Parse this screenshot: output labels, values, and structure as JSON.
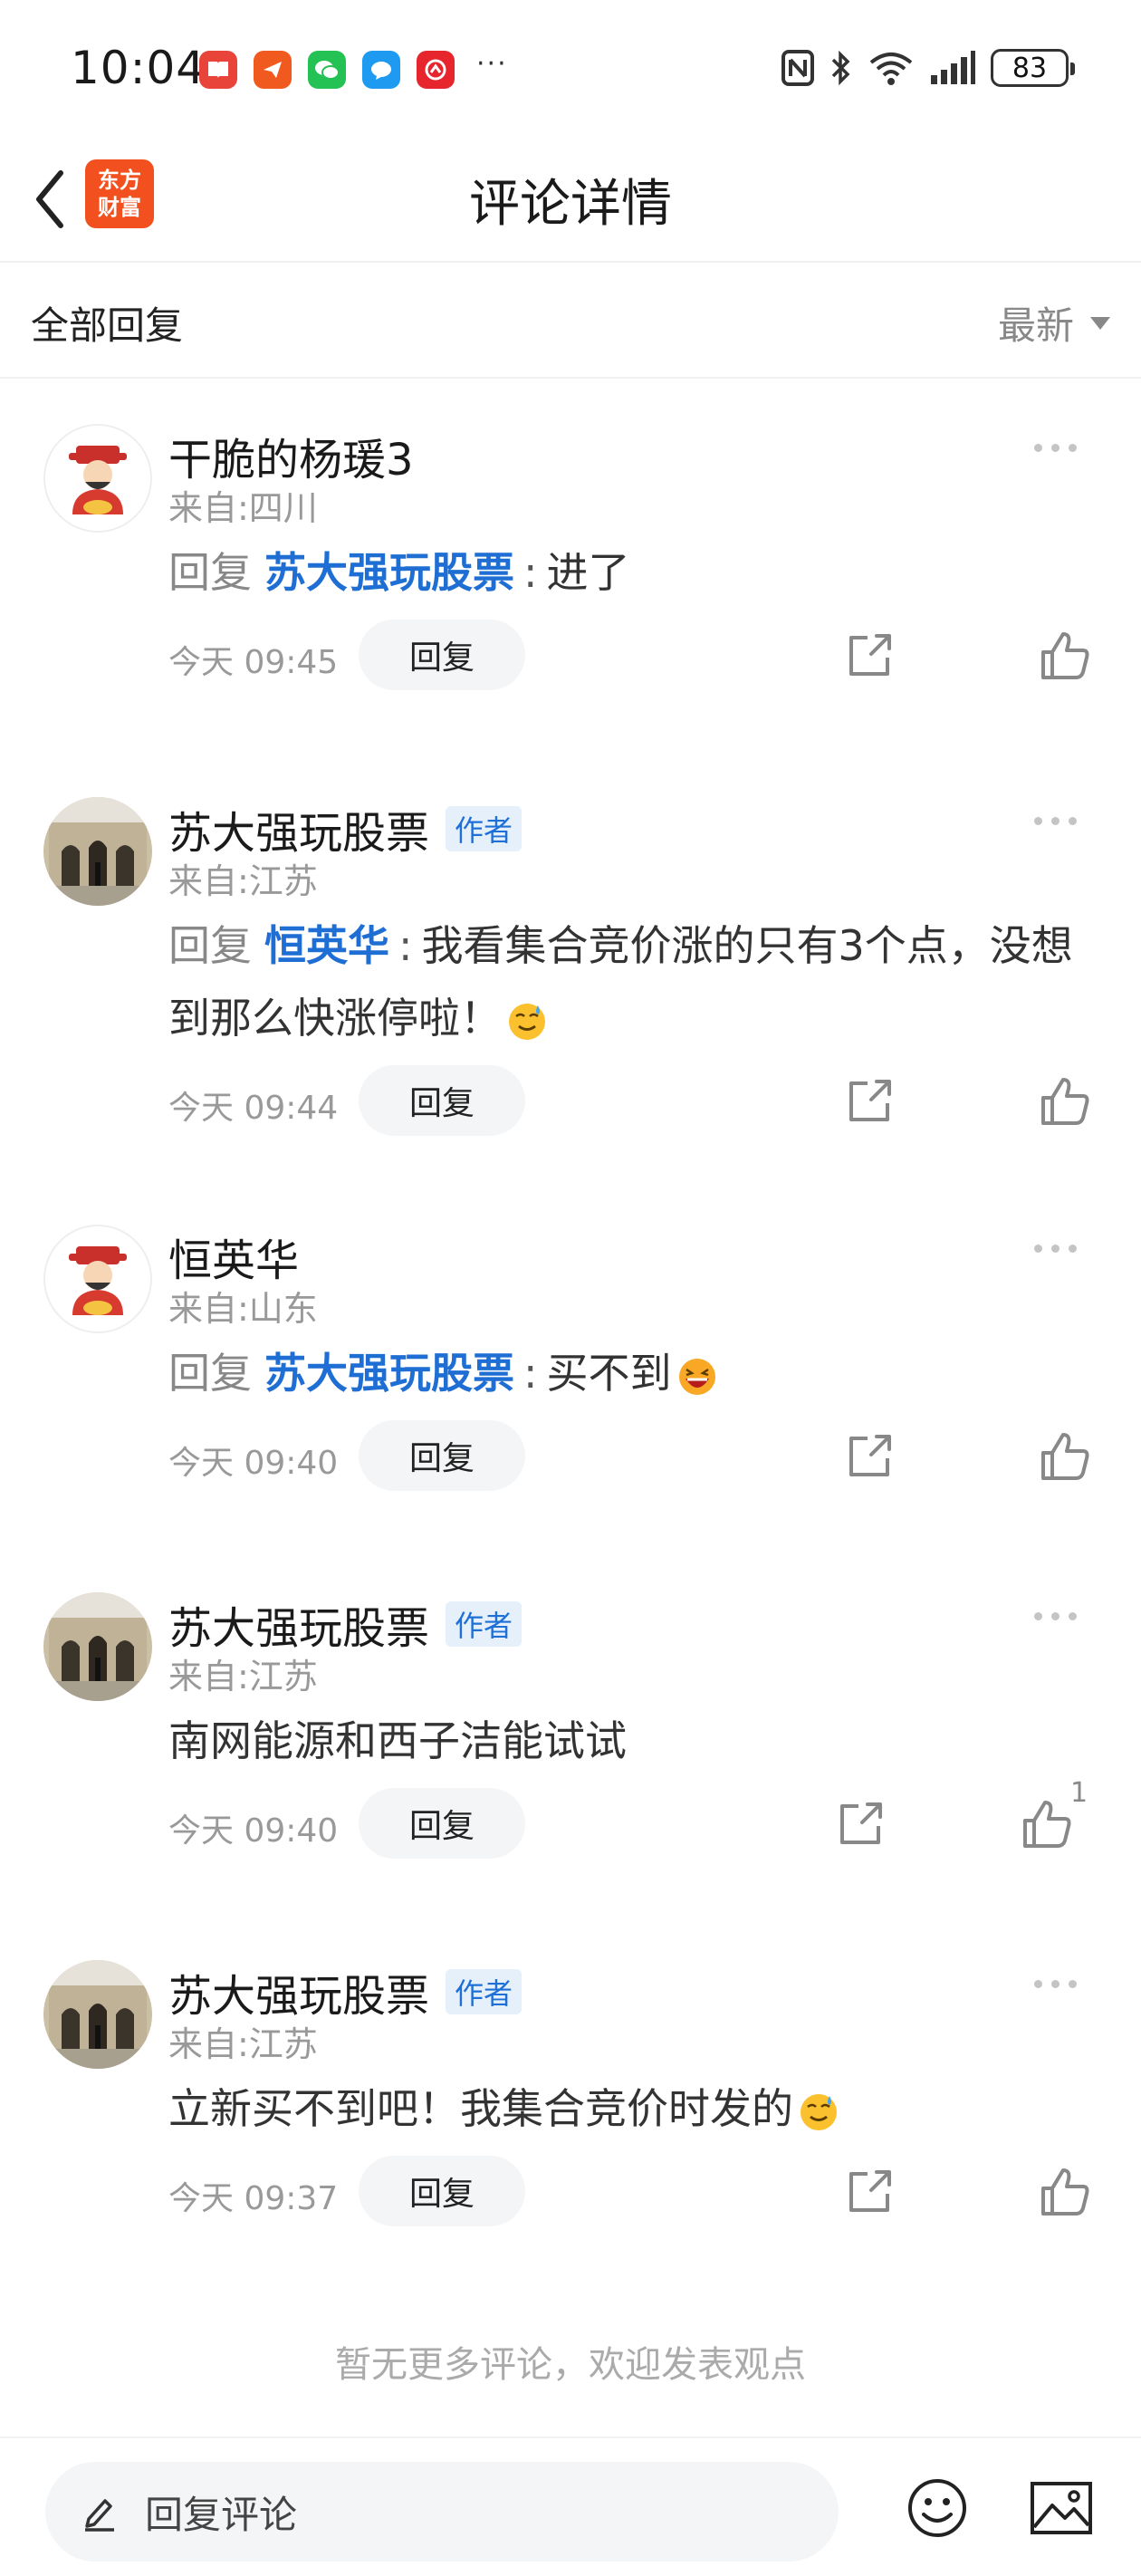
{
  "status_bar": {
    "time": "10:04",
    "battery": "83",
    "more": "···"
  },
  "header": {
    "title": "评论详情",
    "logo_line1": "东方",
    "logo_line2": "财富"
  },
  "section": {
    "title": "全部回复",
    "sort": "最新"
  },
  "labels": {
    "reply_keyword": "回复",
    "reply_button": "回复",
    "author_badge": "作者"
  },
  "comments": [
    {
      "username": "干脆的杨瑗3",
      "location": "来自:四川",
      "is_author": false,
      "reply_to": "苏大强玩股票",
      "text": "进了",
      "emoji": "",
      "time": "今天 09:45",
      "likes": ""
    },
    {
      "username": "苏大强玩股票",
      "location": "来自:江苏",
      "is_author": true,
      "reply_to": "恒英华",
      "text": "我看集合竞价涨的只有3个点，没想到那么快涨停啦！",
      "emoji": "sweat-smile",
      "time": "今天 09:44",
      "likes": ""
    },
    {
      "username": "恒英华",
      "location": "来自:山东",
      "is_author": false,
      "reply_to": "苏大强玩股票",
      "text": "买不到",
      "emoji": "laughing",
      "time": "今天 09:40",
      "likes": ""
    },
    {
      "username": "苏大强玩股票",
      "location": "来自:江苏",
      "is_author": true,
      "reply_to": "",
      "text": "南网能源和西子洁能试试",
      "emoji": "",
      "time": "今天 09:40",
      "likes": "1"
    },
    {
      "username": "苏大强玩股票",
      "location": "来自:江苏",
      "is_author": true,
      "reply_to": "",
      "text": "立新买不到吧！我集合竞价时发的",
      "emoji": "sweat-smile",
      "time": "今天 09:37",
      "likes": ""
    }
  ],
  "no_more_text": "暂无更多评论，欢迎发表观点",
  "input": {
    "placeholder": "回复评论"
  }
}
